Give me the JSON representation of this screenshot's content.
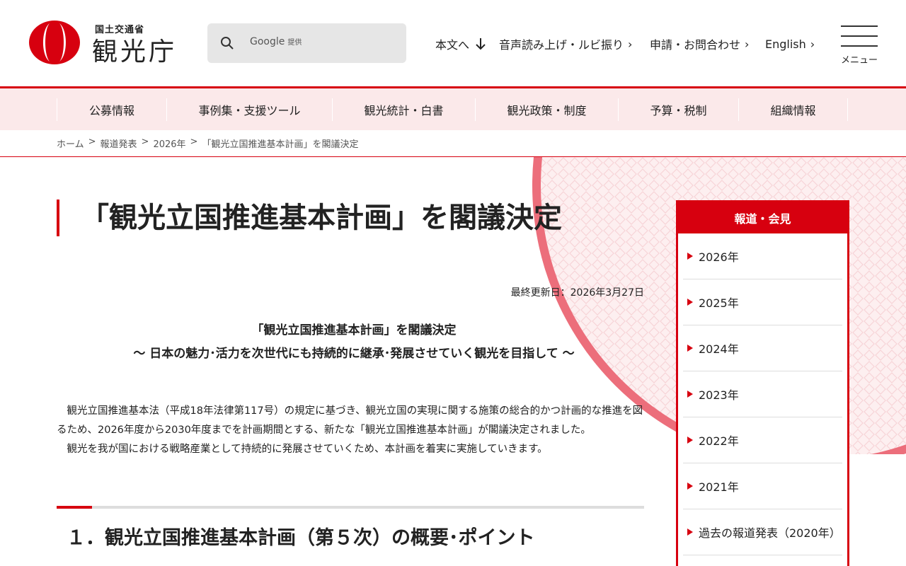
{
  "header": {
    "agency_small": "国土交通省",
    "agency_big": "観光庁",
    "search": {
      "provider": "Google",
      "provider_suffix": "提供"
    },
    "util_links": [
      {
        "label": "本文へ",
        "icon": "arrow-down-icon"
      },
      {
        "label": "音声読み上げ・ルビ振り",
        "icon": "chevron-right-icon"
      },
      {
        "label": "申請・お問合わせ",
        "icon": "chevron-right-icon"
      },
      {
        "label": "English",
        "icon": "chevron-right-icon"
      }
    ],
    "menu_label": "メニュー"
  },
  "main_nav": [
    {
      "label": "公募情報"
    },
    {
      "label": "事例集・支援ツール"
    },
    {
      "label": "観光統計・白書"
    },
    {
      "label": "観光政策・制度"
    },
    {
      "label": "予算・税制"
    },
    {
      "label": "組織情報"
    }
  ],
  "breadcrumb": [
    "ホーム",
    "報道発表",
    "2026年",
    "「観光立国推進基本計画」を閣議決定"
  ],
  "breadcrumb_sep": ">",
  "content": {
    "title": "「観光立国推進基本計画」を閣議決定",
    "updated": "最終更新日：2026年3月27日",
    "lead_title": "「観光立国推進基本計画」を閣議決定",
    "lead_sub": "～ 日本の魅力･活力を次世代にも持続的に継承･発展させていく観光を目指して ～",
    "paragraph1": "観光立国推進基本法（平成18年法律第117号）の規定に基づき、観光立国の実現に関する施策の総合的かつ計画的な推進を図るため、2026年度から2030年度までを計画期間とする、新たな「観光立国推進基本計画」が閣議決定されました。",
    "paragraph2": "観光を我が国における戦略産業として持続的に発展させていくため、本計画を着実に実施していきます。",
    "section_title": "１．観光立国推進基本計画（第５次）の概要･ポイント"
  },
  "sidebar": {
    "heading": "報道・会見",
    "links": [
      "2026年",
      "2025年",
      "2024年",
      "2023年",
      "2022年",
      "2021年",
      "過去の報道発表（2020年）"
    ]
  },
  "colors": {
    "brand_red": "#d7000f",
    "nav_bg": "#fbe9ea"
  }
}
